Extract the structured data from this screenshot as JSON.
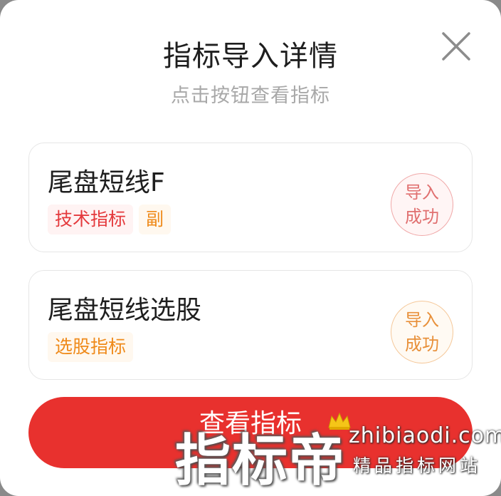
{
  "dialog": {
    "title": "指标导入详情",
    "subtitle": "点击按钮查看指标",
    "close_icon": "close-icon"
  },
  "indicators": [
    {
      "name": "尾盘短线F",
      "tags": [
        "技术指标",
        "副"
      ],
      "status": [
        "导入",
        "成功"
      ],
      "stamp_color": "#e07070"
    },
    {
      "name": "尾盘短线选股",
      "tags": [
        "选股指标"
      ],
      "status": [
        "导入",
        "成功"
      ],
      "stamp_color": "#e8903a"
    }
  ],
  "view_button": {
    "label": "查看指标",
    "color": "#e8312e"
  },
  "watermark": {
    "brand": "指标帝",
    "url": "zhibiaodi.com",
    "slogan": "精品指标网站"
  }
}
